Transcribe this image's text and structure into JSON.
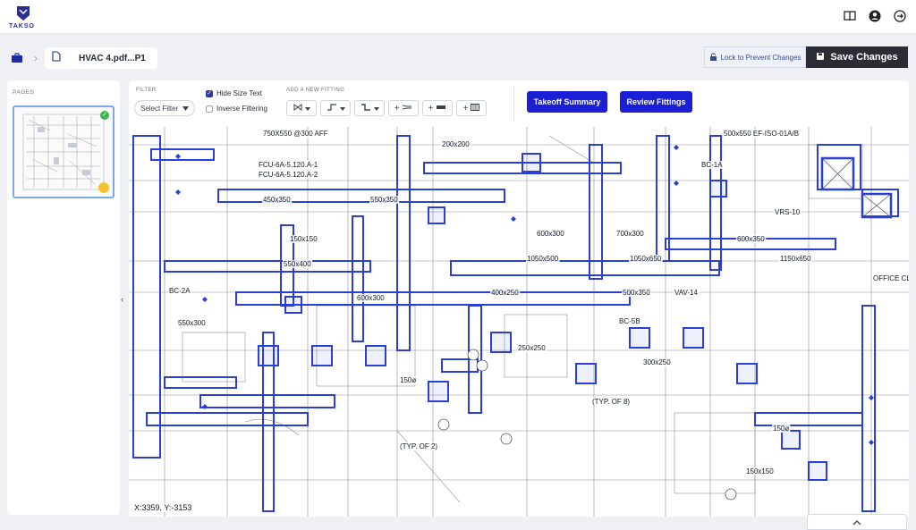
{
  "app": {
    "logo_text": "TAKSO"
  },
  "topbar": {
    "icons": [
      "book-icon",
      "user-avatar-icon",
      "logout-icon"
    ]
  },
  "breadcrumb": {
    "separator": "›",
    "file_name": "HVAC 4.pdf...P1"
  },
  "actions": {
    "lock_label": "Lock to Prevent Changes",
    "save_label": "Save Changes"
  },
  "pages": {
    "title": "PAGES"
  },
  "toolbar": {
    "filter_title": "FILTER",
    "select_filter": "Select Filter",
    "hide_size_text": {
      "label": "Hide Size Text",
      "checked": true
    },
    "inverse_filtering": {
      "label": "Inverse Filtering",
      "checked": false
    },
    "fitting_title": "ADD A NEW FITTING",
    "fitting_tools": [
      "valve-tool",
      "elbow-tool",
      "offset-tool",
      "add-reducer",
      "add-duct",
      "add-grille"
    ],
    "takeoff_summary": "Takeoff Summary",
    "review_fittings": "Review Fittings"
  },
  "drawing": {
    "labels": [
      {
        "t": "750X550 @300 AFF"
      },
      {
        "t": "FCU-6A-5.120.A-1"
      },
      {
        "t": "FCU-6A-5.120.A-2"
      },
      {
        "t": "500x550 EF-ISO-01A/B"
      },
      {
        "t": "200x200"
      },
      {
        "t": "450x350"
      },
      {
        "t": "550x350"
      },
      {
        "t": "150x150"
      },
      {
        "t": "600x300"
      },
      {
        "t": "700x300"
      },
      {
        "t": "600x350"
      },
      {
        "t": "1050x500"
      },
      {
        "t": "1050x650"
      },
      {
        "t": "1150x650"
      },
      {
        "t": "550x400"
      },
      {
        "t": "500x350"
      },
      {
        "t": "400x250"
      },
      {
        "t": "250x250"
      },
      {
        "t": "300x250"
      },
      {
        "t": "550x300"
      },
      {
        "t": "600x300"
      },
      {
        "t": "150x150"
      },
      {
        "t": "BC-2A"
      },
      {
        "t": "BC-1A"
      },
      {
        "t": "BC-5B"
      },
      {
        "t": "VAV-14"
      },
      {
        "t": "VRS-10"
      },
      {
        "t": "(TYP. OF 2)"
      },
      {
        "t": "(TYP. OF 8)"
      },
      {
        "t": "150ø"
      },
      {
        "t": "150ø"
      },
      {
        "t": "OFFICE CLINICAL"
      }
    ],
    "coordinates": "X:3359, Y:-3153"
  },
  "colors": {
    "fitting": "#2a3fd6",
    "drawing": "#7a7f8c",
    "accent_button": "#1d1fd6",
    "save_bg": "#2a2d35"
  }
}
